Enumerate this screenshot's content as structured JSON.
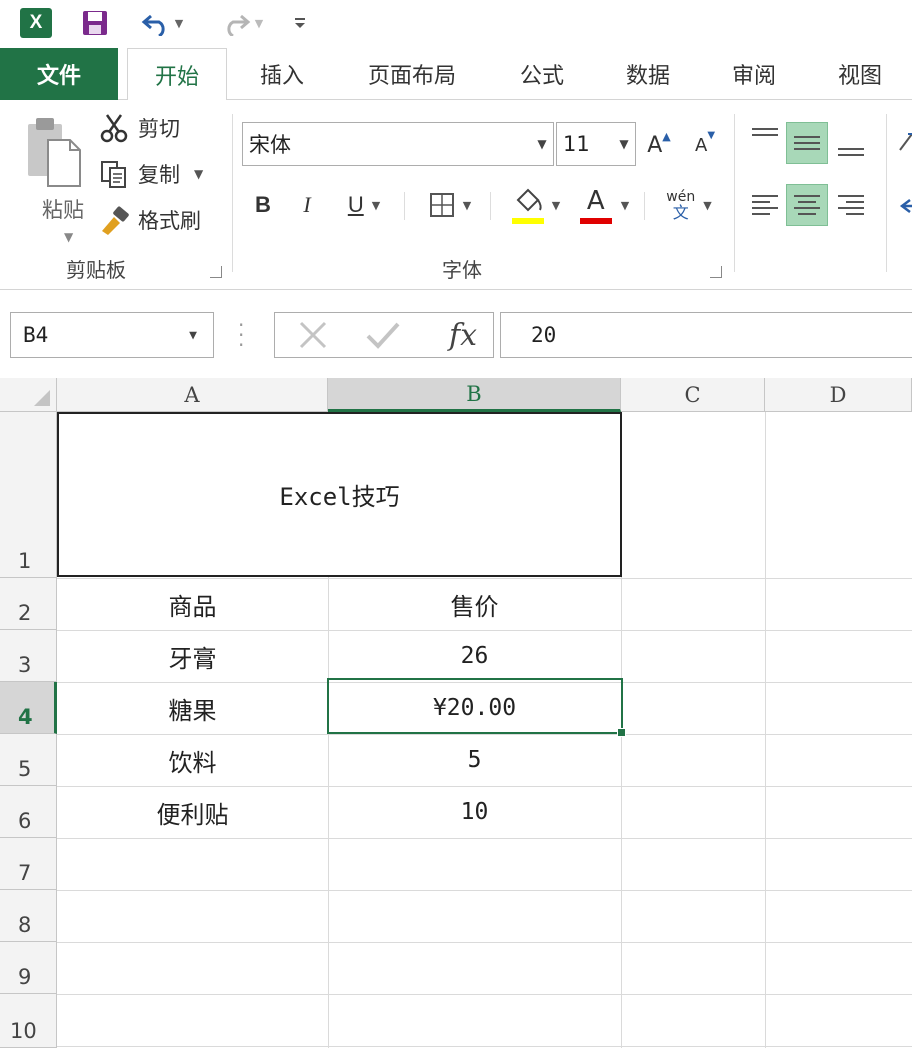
{
  "qat": {
    "logo_text": "X",
    "icons": [
      "excel-logo-icon",
      "save-icon",
      "undo-icon",
      "redo-icon",
      "customize-icon"
    ]
  },
  "tabs": [
    {
      "name": "file",
      "label": "文件"
    },
    {
      "name": "home",
      "label": "开始"
    },
    {
      "name": "insert",
      "label": "插入"
    },
    {
      "name": "page-layout",
      "label": "页面布局"
    },
    {
      "name": "formulas",
      "label": "公式"
    },
    {
      "name": "data",
      "label": "数据"
    },
    {
      "name": "review",
      "label": "审阅"
    },
    {
      "name": "view",
      "label": "视图"
    }
  ],
  "ribbon": {
    "clipboard": {
      "paste": "粘贴",
      "cut": "剪切",
      "copy": "复制",
      "format_painter": "格式刷",
      "group": "剪贴板"
    },
    "font": {
      "name": "宋体",
      "size": "11",
      "bold": "B",
      "italic": "I",
      "underline": "U",
      "grow": "A",
      "shrink": "A",
      "font_color_letter": "A",
      "phonetic_top": "wén",
      "phonetic_bottom": "文",
      "group": "字体",
      "fill_color": "#ffff00",
      "font_color": "#e00000"
    }
  },
  "formula_bar": {
    "name_box": "B4",
    "fx": "fx",
    "value": "20"
  },
  "columns": [
    "A",
    "B",
    "C",
    "D"
  ],
  "rows": [
    "1",
    "2",
    "3",
    "4",
    "5",
    "6",
    "7",
    "8",
    "9",
    "10"
  ],
  "cells": {
    "title": "Excel技巧",
    "a2": "商品",
    "b2": "售价",
    "a3": "牙膏",
    "b3": "26",
    "a4": "糖果",
    "b4": "¥20.00",
    "a5": "饮料",
    "b5": "5",
    "a6": "便利贴",
    "b6": "10"
  },
  "colors": {
    "accent": "#217346",
    "selected_fill": "#a8d8b8"
  }
}
